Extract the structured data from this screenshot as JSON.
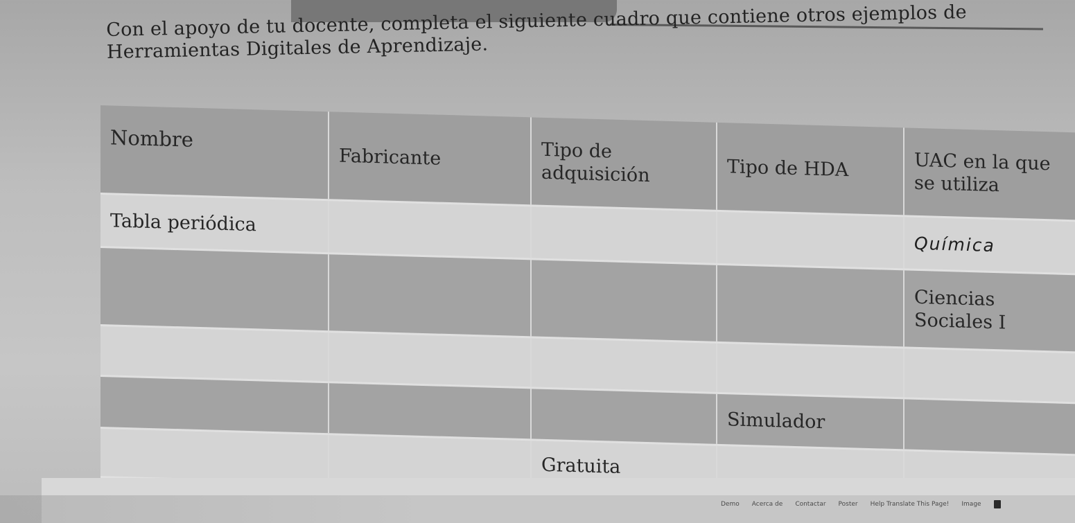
{
  "instructions": "Con el apoyo de tu docente, completa el siguiente cuadro que contiene otros ejemplos de Herramientas Digitales de Aprendizaje.",
  "table": {
    "headers": [
      "Nombre",
      "Fabricante",
      "Tipo de adquisición",
      "Tipo de HDA",
      "UAC en la que se utiliza"
    ],
    "rows": [
      [
        "Tabla periódica",
        "",
        "",
        "",
        "Química"
      ],
      [
        "",
        "",
        "",
        "",
        "Ciencias Sociales I"
      ],
      [
        "",
        "",
        "",
        "",
        ""
      ],
      [
        "",
        "",
        "",
        "Simulador",
        ""
      ],
      [
        "",
        "",
        "Gratuita",
        "",
        ""
      ]
    ]
  },
  "footer": {
    "links": [
      "Demo",
      "Acerca de",
      "Contactar",
      "Poster",
      "Help Translate This Page!",
      "Image"
    ],
    "icon": "document-icon"
  },
  "colors": {
    "header_bg": "#9e9e9e",
    "row_light": "#d4d4d4",
    "row_dark": "#a3a3a3"
  }
}
